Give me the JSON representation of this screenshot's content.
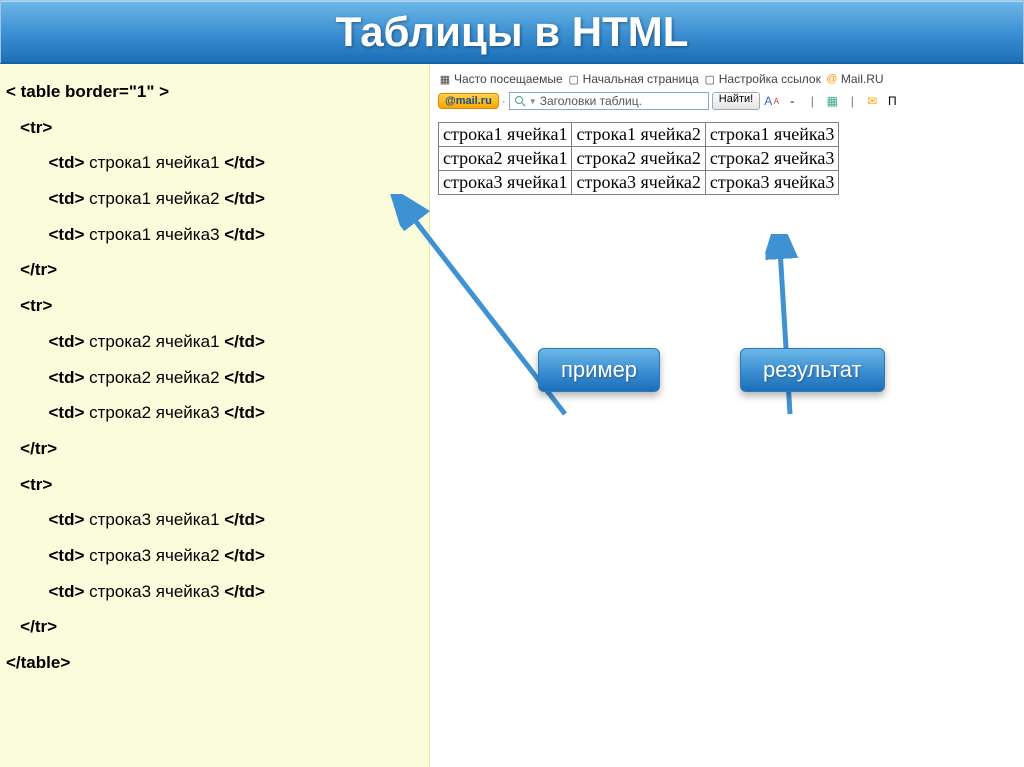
{
  "title": "Таблицы в HTML",
  "code": {
    "l0": "< table border=\"1\" >",
    "l1": "   <tr>",
    "l2a": "         <td>",
    "l2b": " строка1 ячейка1 ",
    "l2c": "</td>",
    "l3a": "         <td>",
    "l3b": " строка1 ячейка2 ",
    "l3c": "</td>",
    "l4a": "         <td>",
    "l4b": " строка1 ячейка3 ",
    "l4c": "</td>",
    "l5": "   </tr>",
    "l6": "   <tr>",
    "l7a": "         <td>",
    "l7b": " строка2 ячейка1 ",
    "l7c": "</td>",
    "l8a": "         <td>",
    "l8b": " строка2 ячейка2 ",
    "l8c": "</td>",
    "l9a": "         <td>",
    "l9b": " строка2 ячейка3 ",
    "l9c": "</td>",
    "l10": "   </tr>",
    "l11": "   <tr>",
    "l12a": "         <td>",
    "l12b": " строка3 ячейка1 ",
    "l12c": "</td>",
    "l13a": "         <td>",
    "l13b": " строка3 ячейка2 ",
    "l13c": "</td>",
    "l14a": "         <td>",
    "l14b": " строка3 ячейка3 ",
    "l14c": "</td>",
    "l15": "   </tr>",
    "l16": "</table>"
  },
  "toolbar": {
    "freq_visited": "Часто посещаемые",
    "home_page": "Начальная страница",
    "link_settings": "Настройка ссылок",
    "mailru": "Mail.RU",
    "mailru_btn": "@mail.ru",
    "search_text": "Заголовки таблиц.",
    "find": "Найти!",
    "ptrunc": "П"
  },
  "result_table": {
    "r1c1": "строка1 ячейка1",
    "r1c2": "строка1 ячейка2",
    "r1c3": "строка1 ячейка3",
    "r2c1": "строка2 ячейка1",
    "r2c2": "строка2 ячейка2",
    "r2c3": "строка2 ячейка3",
    "r3c1": "строка3 ячейка1",
    "r3c2": "строка3 ячейка2",
    "r3c3": "строка3 ячейка3"
  },
  "callouts": {
    "example": "пример",
    "result": "результат"
  }
}
